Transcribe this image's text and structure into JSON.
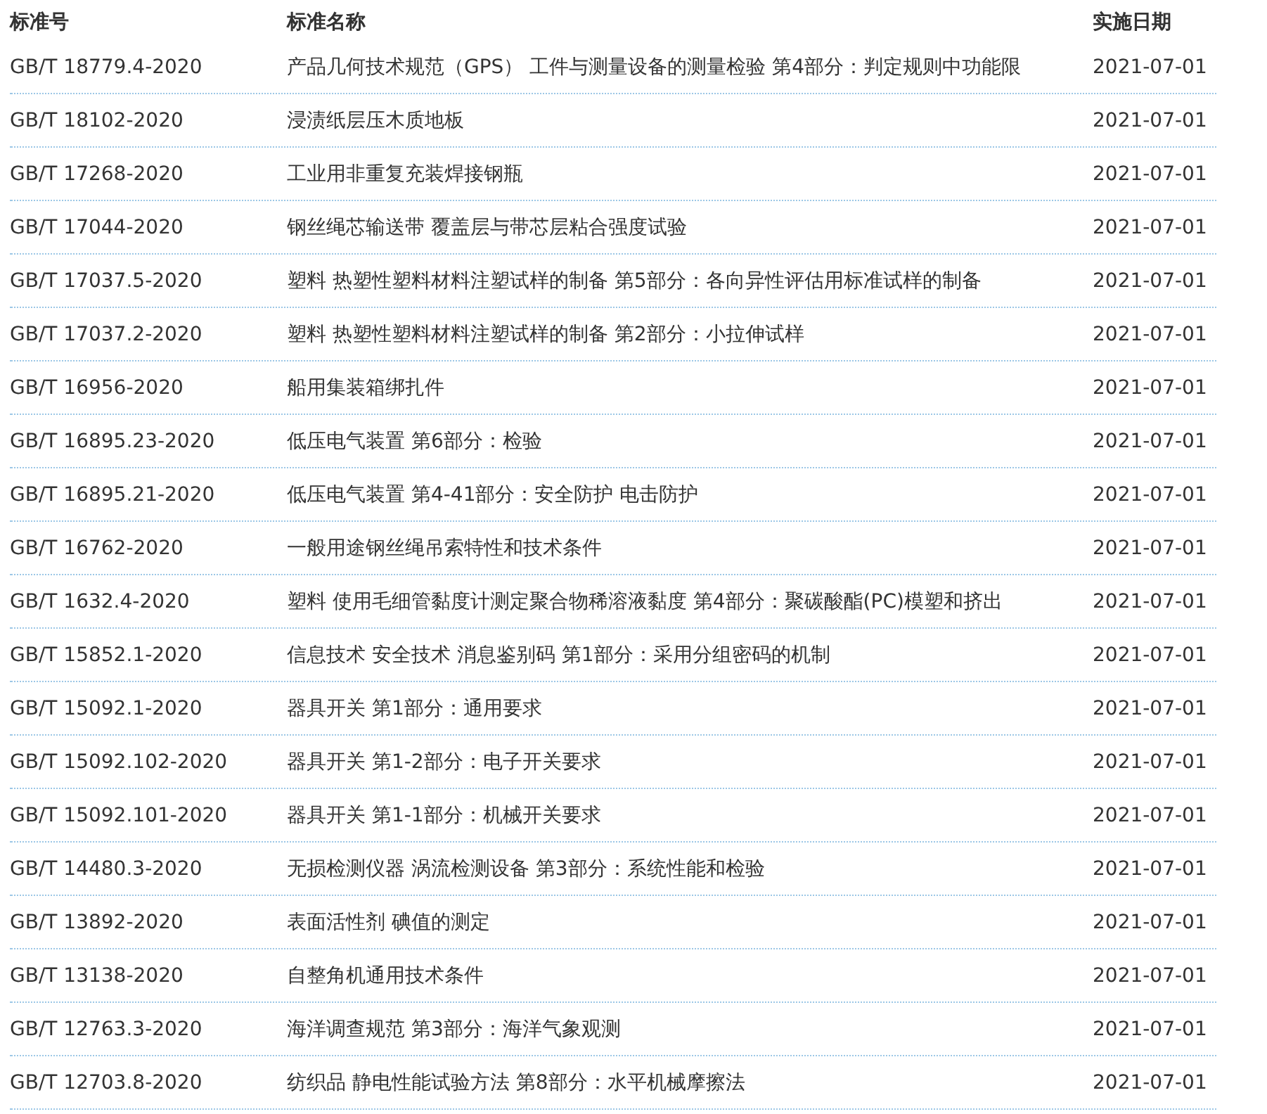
{
  "table": {
    "columns": [
      "标准号",
      "标准名称",
      "实施日期"
    ],
    "rows": [
      [
        "GB/T 18779.4-2020",
        "产品几何技术规范（GPS） 工件与测量设备的测量检验 第4部分：判定规则中功能限",
        "2021-07-01"
      ],
      [
        "GB/T 18102-2020",
        "浸渍纸层压木质地板",
        "2021-07-01"
      ],
      [
        "GB/T 17268-2020",
        "工业用非重复充装焊接钢瓶",
        "2021-07-01"
      ],
      [
        "GB/T 17044-2020",
        "钢丝绳芯输送带 覆盖层与带芯层粘合强度试验",
        "2021-07-01"
      ],
      [
        "GB/T 17037.5-2020",
        "塑料 热塑性塑料材料注塑试样的制备 第5部分：各向异性评估用标准试样的制备",
        "2021-07-01"
      ],
      [
        "GB/T 17037.2-2020",
        "塑料 热塑性塑料材料注塑试样的制备 第2部分：小拉伸试样",
        "2021-07-01"
      ],
      [
        "GB/T 16956-2020",
        "船用集装箱绑扎件",
        "2021-07-01"
      ],
      [
        "GB/T 16895.23-2020",
        "低压电气装置 第6部分：检验",
        "2021-07-01"
      ],
      [
        "GB/T 16895.21-2020",
        "低压电气装置 第4-41部分：安全防护 电击防护",
        "2021-07-01"
      ],
      [
        "GB/T 16762-2020",
        "一般用途钢丝绳吊索特性和技术条件",
        "2021-07-01"
      ],
      [
        "GB/T 1632.4-2020",
        "塑料 使用毛细管黏度计测定聚合物稀溶液黏度 第4部分：聚碳酸酯(PC)模塑和挤出",
        "2021-07-01"
      ],
      [
        "GB/T 15852.1-2020",
        "信息技术 安全技术 消息鉴别码 第1部分：采用分组密码的机制",
        "2021-07-01"
      ],
      [
        "GB/T 15092.1-2020",
        "器具开关 第1部分：通用要求",
        "2021-07-01"
      ],
      [
        "GB/T 15092.102-2020",
        "器具开关 第1-2部分：电子开关要求",
        "2021-07-01"
      ],
      [
        "GB/T 15092.101-2020",
        "器具开关 第1-1部分：机械开关要求",
        "2021-07-01"
      ],
      [
        "GB/T 14480.3-2020",
        "无损检测仪器 涡流检测设备 第3部分：系统性能和检验",
        "2021-07-01"
      ],
      [
        "GB/T 13892-2020",
        "表面活性剂 碘值的测定",
        "2021-07-01"
      ],
      [
        "GB/T 13138-2020",
        "自整角机通用技术条件",
        "2021-07-01"
      ],
      [
        "GB/T 12763.3-2020",
        "海洋调查规范 第3部分：海洋气象观测",
        "2021-07-01"
      ],
      [
        "GB/T 12703.8-2020",
        "纺织品 静电性能试验方法 第8部分：水平机械摩擦法",
        "2021-07-01"
      ]
    ]
  }
}
